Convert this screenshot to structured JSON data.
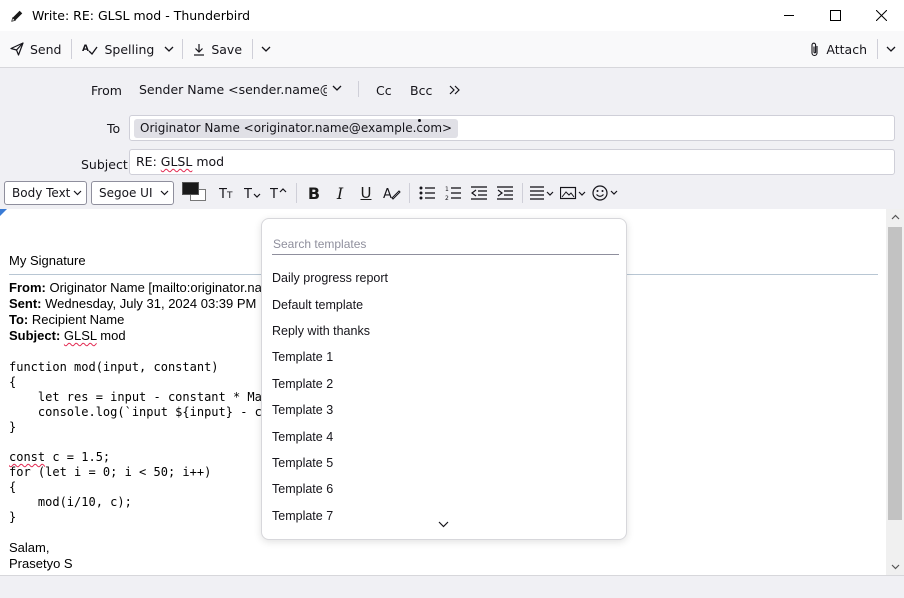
{
  "window": {
    "title": "Write: RE: GLSL mod - Thunderbird"
  },
  "toolbar": {
    "send_label": "Send",
    "spelling_label": "Spelling",
    "save_label": "Save",
    "attach_label": "Attach"
  },
  "headers": {
    "from_label": "From",
    "from_value": "Sender Name <sender.name@example.com>",
    "cc_label": "Cc",
    "bcc_label": "Bcc",
    "to_label": "To",
    "to_recipient": "Originator Name <originator.name@example.com>",
    "subject_label": "Subject",
    "subject_prefix": "RE: ",
    "subject_word": "GLSL",
    "subject_suffix": " mod"
  },
  "format": {
    "paragraph_style": "Body Text",
    "font": "Segoe UI",
    "text_color": "#1a1a1a",
    "background_color": "#ffffff"
  },
  "body": {
    "signature": "My Signature",
    "from_label": "From:",
    "from_value": " Originator Name [mailto:originator.na",
    "sent_label": "Sent:",
    "sent_value": " Wednesday, July 31, 2024 03:39 PM",
    "to_label": "To:",
    "to_value": " Recipient Name",
    "subject_label": "Subject:",
    "subject_word": "GLSL",
    "subject_suffix": " mod",
    "code_lines": [
      "function mod(input, constant)",
      "{",
      "    let res = input - constant * Mat",
      "    console.log(`input ${input} - co",
      "}",
      "",
      "const",
      " c = 1.5;",
      "for (let i = 0; i < 50; i++)",
      "{",
      "    mod(i/10, c);",
      "}"
    ],
    "closing": "Salam,",
    "sender_name": "Prasetyo S"
  },
  "templates_popup": {
    "search_placeholder": "Search templates",
    "items": [
      "Daily progress report",
      "Default template",
      "Reply with thanks",
      "Template 1",
      "Template 2",
      "Template 3",
      "Template 4",
      "Template 5",
      "Template 6",
      "Template 7"
    ]
  }
}
